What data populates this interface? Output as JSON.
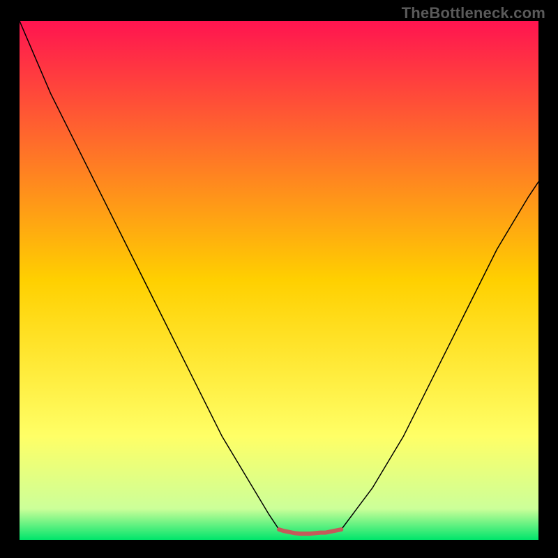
{
  "header": {
    "source_label": "TheBottleneck.com"
  },
  "chart_data": {
    "type": "line",
    "title": "",
    "xlabel": "",
    "ylabel": "",
    "xlim": [
      0,
      100
    ],
    "ylim": [
      0,
      100
    ],
    "grid": false,
    "legend": false,
    "background_gradient": {
      "stops": [
        {
          "offset": 0.0,
          "color": "#ff1450"
        },
        {
          "offset": 0.5,
          "color": "#ffd000"
        },
        {
          "offset": 0.8,
          "color": "#ffff66"
        },
        {
          "offset": 0.94,
          "color": "#ccff99"
        },
        {
          "offset": 1.0,
          "color": "#00e56b"
        }
      ]
    },
    "series": [
      {
        "name": "bottleneck-curve-left",
        "color": "#000000",
        "width": 1.5,
        "x": [
          0,
          3,
          6,
          9,
          12,
          15,
          18,
          21,
          24,
          27,
          30,
          33,
          36,
          39,
          42,
          45,
          48,
          50
        ],
        "y": [
          100,
          93,
          86,
          80,
          74,
          68,
          62,
          56,
          50,
          44,
          38,
          32,
          26,
          20,
          15,
          10,
          5,
          2
        ]
      },
      {
        "name": "bottleneck-curve-right",
        "color": "#000000",
        "width": 1.5,
        "x": [
          62,
          65,
          68,
          71,
          74,
          77,
          80,
          83,
          86,
          89,
          92,
          95,
          98,
          100
        ],
        "y": [
          2,
          6,
          10,
          15,
          20,
          26,
          32,
          38,
          44,
          50,
          56,
          61,
          66,
          69
        ]
      },
      {
        "name": "flat-bottom-segment",
        "color": "#c45a5a",
        "width": 6,
        "x": [
          50,
          51,
          52,
          53,
          54,
          55,
          56,
          57,
          58,
          59,
          60,
          61,
          62
        ],
        "y": [
          2,
          1.7,
          1.5,
          1.3,
          1.2,
          1.2,
          1.2,
          1.3,
          1.4,
          1.4,
          1.6,
          1.8,
          2
        ]
      }
    ],
    "annotations": []
  }
}
